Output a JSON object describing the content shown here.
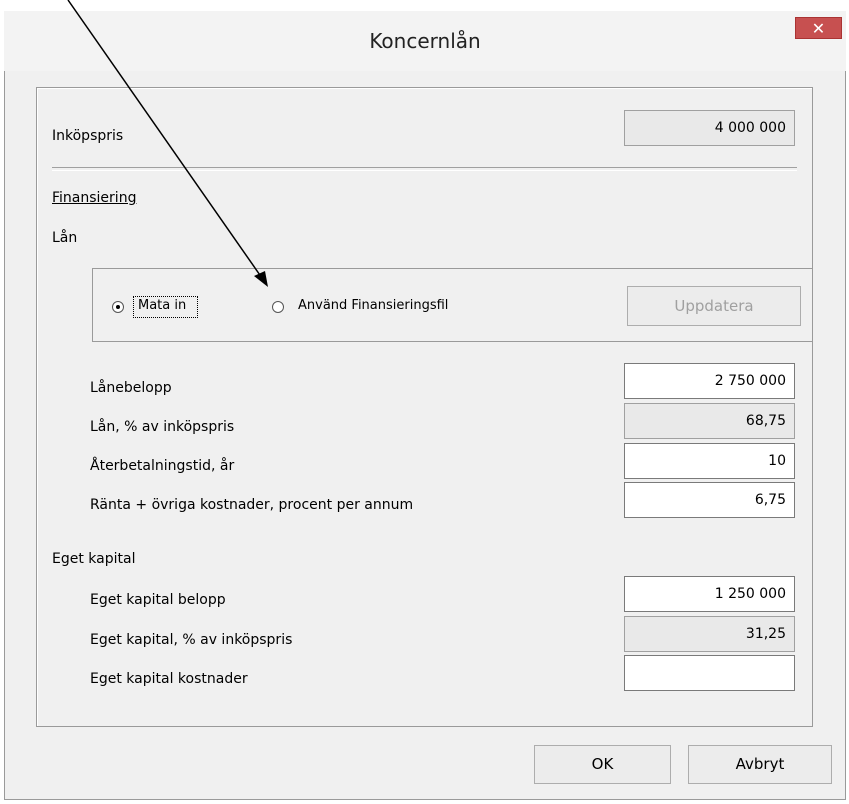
{
  "window": {
    "title": "Koncernlån",
    "close_glyph": "✕"
  },
  "purchase": {
    "label": "Inköpspris",
    "value": "4 000 000"
  },
  "financing": {
    "heading": "Finansiering",
    "loan_heading": "Lån",
    "mode": {
      "options": [
        {
          "label": "Mata in",
          "selected": true
        },
        {
          "label": "Använd Finansieringsfil",
          "selected": false
        }
      ],
      "update_button": "Uppdatera"
    },
    "loan_fields": [
      {
        "label": "Lånebelopp",
        "value": "2 750 000",
        "editable": true
      },
      {
        "label": "Lån, % av inköpspris",
        "value": "68,75",
        "editable": false
      },
      {
        "label": "Återbetalningstid, år",
        "value": "10",
        "editable": true
      },
      {
        "label": "Ränta + övriga kostnader, procent per annum",
        "value": "6,75",
        "editable": true
      }
    ],
    "equity_heading": "Eget kapital",
    "equity_fields": [
      {
        "label": "Eget kapital belopp",
        "value": "1 250 000",
        "editable": true
      },
      {
        "label": "Eget kapital, % av inköpspris",
        "value": "31,25",
        "editable": false
      },
      {
        "label": "Eget kapital kostnader",
        "value": "",
        "editable": true
      }
    ]
  },
  "buttons": {
    "ok": "OK",
    "cancel": "Avbryt"
  },
  "annotation": {
    "icon": "arrow-icon",
    "color": "#000000"
  }
}
